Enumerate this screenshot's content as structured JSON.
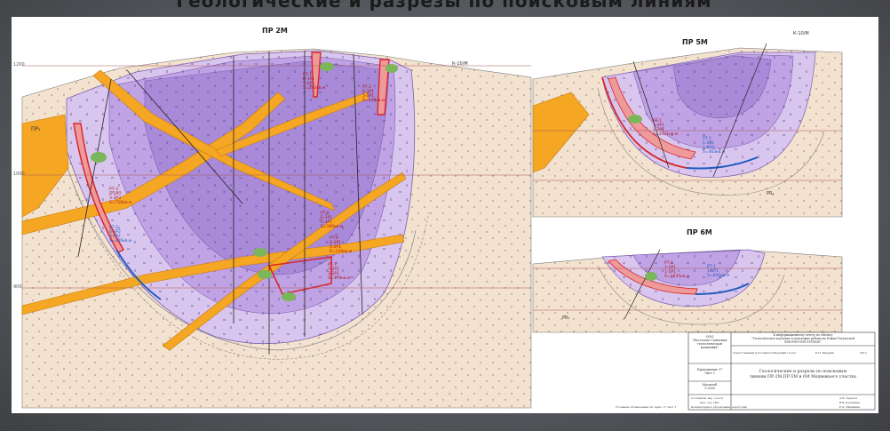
{
  "document": {
    "banner_title": "Геологические и разрезы по поисковым линиям",
    "colors": {
      "host_rock": "#f3e2cf",
      "intrusion_light": "#d9c6ee",
      "intrusion_mid": "#c0a3e4",
      "intrusion_dark": "#a88ad8",
      "dike": "#f5a623",
      "ore_body": "#d7282b",
      "blue_zone": "#1f5bbf"
    }
  },
  "sections": {
    "pr2": {
      "title": "ПР 2М",
      "label_left": "ПР₁",
      "label_right": "К-10/М",
      "ore_blocks": [
        {
          "lines": [
            "РТ-3",
            "Б-1РП",
            "З-3РЗ",
            "S=716кв.м"
          ]
        },
        {
          "lines": [
            "РТ-2",
            "6-ЗР2",
            "3-РР2",
            "S=306кв.м"
          ]
        },
        {
          "lines": [
            "РТ-1",
            "Б-1Р1",
            "5-2Р1",
            "S=240кв.м"
          ]
        },
        {
          "lines": [
            "РТ-2",
            "Б-3Р1",
            "5-3Р1",
            "S=440кв.м"
          ]
        },
        {
          "lines": [
            "РТ-5",
            "Б-1Р1",
            "5-3Р1",
            "S=160кв.м"
          ]
        },
        {
          "lines": [
            "РТ-6",
            "Б-1Р1",
            "3-2Р1",
            "S=130кв.м"
          ]
        },
        {
          "lines": [
            "РТ-7",
            "7-2Р1",
            "3-2Р1",
            "S=170кв.м"
          ]
        }
      ],
      "depth_marks": [
        "1200",
        "1000",
        "900"
      ]
    },
    "pr5": {
      "title": "ПР 5М",
      "label_top": "К-10/М",
      "ore_block": {
        "lines": [
          "РТ-1",
          "1-ЗР1",
          "1-2Р1",
          "S=3421кв.м"
        ]
      },
      "blue_block": {
        "lines": [
          "РТ-1",
          "1-2Р1",
          "1-6Р3",
          "S=463кв.м"
        ]
      },
      "label_bottom": "РR₁"
    },
    "pr6": {
      "title": "ПР 6М",
      "ore_block": {
        "lines": [
          "РТ-1",
          "1-2Р1",
          "1-5Р1",
          "S=2835кв.м"
        ]
      },
      "blue_block": {
        "lines": [
          "РТ-1",
          "1-6Р1",
          "S=605кв.м"
        ]
      },
      "label_bottom": "РR₁"
    }
  },
  "title_block": {
    "company": [
      "ООО",
      "\"Восточно-Саянская",
      "геологическая",
      "компания\""
    ],
    "report_line": "К информационному отчету по объекту",
    "report_title": [
      "\"Геологическое изучение и поисковые работы на Южно-Тагульской",
      "никеленосной площади\""
    ],
    "roles": {
      "responsible": "Ответственный исполнитель",
      "chief": "Ведущий геолог",
      "name": "К.П. Шадрин",
      "year": "2012"
    },
    "appendix": [
      "Приложение 17",
      "Лист 1"
    ],
    "main_title": [
      "Геологические и разрезы по поисковым",
      "линиям ПР-2М,ПР-5М и 6М Медвежьего участка"
    ],
    "scale": [
      "Масштаб",
      "1:2000"
    ],
    "signers": [
      {
        "role": "Составили:  вед. геолог",
        "name": "А.В. Терехов"
      },
      {
        "role": "нач. отд. ГИС",
        "name": "В.В. Кузьмина"
      },
      {
        "role": "Компьютерное оформление: картограф",
        "name": "Е.А. Шишкина"
      }
    ],
    "legend_ref": "Условные обозначения см. прил. 17 лист 1"
  }
}
